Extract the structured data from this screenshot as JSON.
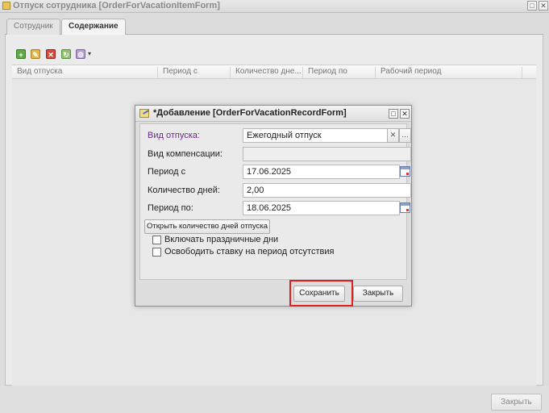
{
  "outer_window": {
    "title": "Отпуск сотрудника [OrderForVacationItemForm]",
    "tabs": [
      {
        "label": "Сотрудник",
        "active": false
      },
      {
        "label": "Содержание",
        "active": true
      }
    ],
    "toolbar_icons": [
      "add-icon",
      "edit-icon",
      "delete-icon",
      "refresh-icon",
      "settings-dropdown-icon"
    ],
    "grid_columns": [
      "Вид отпуска",
      "Период с",
      "Количество дне...",
      "Период по",
      "Рабочий период"
    ],
    "close_label": "Закрыть"
  },
  "dialog": {
    "title": "*Добавление [OrderForVacationRecordForm]",
    "fields": {
      "vacation_type": {
        "label": "Вид отпуска:",
        "value": "Ежегодный отпуск"
      },
      "compensation_type": {
        "label": "Вид компенсации:",
        "value": ""
      },
      "period_from": {
        "label": "Период с",
        "value": "17.06.2025"
      },
      "days_count": {
        "label": "Количество дней:",
        "value": "2,00"
      },
      "period_to": {
        "label": "Период по:",
        "value": "18.06.2025"
      }
    },
    "open_days_button": "Открыть количество дней отпуска",
    "checkboxes": [
      {
        "label": "Включать праздничные дни",
        "checked": false
      },
      {
        "label": "Освободить ставку на период отсутствия",
        "checked": false
      }
    ],
    "save_label": "Сохранить",
    "close_label": "Закрыть"
  },
  "colors": {
    "highlight": "#e02020",
    "required_label": "#6a2d8a"
  }
}
